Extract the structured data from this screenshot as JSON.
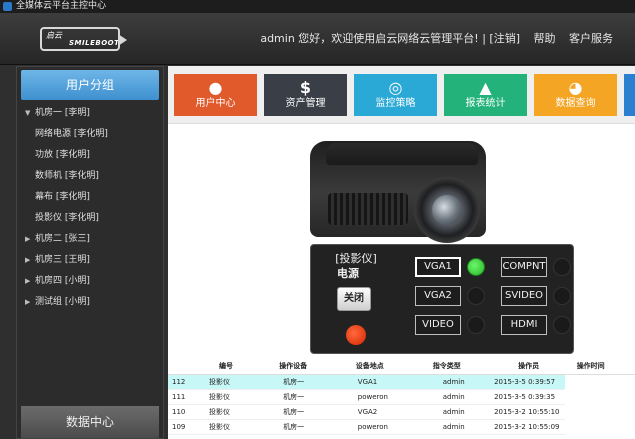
{
  "window": {
    "title": "全媒体云平台主控中心"
  },
  "header": {
    "logo_mark": "启云",
    "logo_text": "SMILEBOOT",
    "welcome": "admin 您好，欢迎使用启云网络云管理平台!",
    "logout": "[注销]",
    "help": "帮助",
    "service": "客户服务"
  },
  "sidebar": {
    "title": "用户分组",
    "items": [
      {
        "label": "机房一 [李明]",
        "type": "group",
        "expanded": true
      },
      {
        "label": "网络电源 [李化明]",
        "type": "child"
      },
      {
        "label": "功放 [李化明]",
        "type": "child"
      },
      {
        "label": "数师机 [李化明]",
        "type": "child"
      },
      {
        "label": "幕布 [李化明]",
        "type": "child"
      },
      {
        "label": "投影仪 [李化明]",
        "type": "child"
      },
      {
        "label": "机房二 [张三]",
        "type": "group",
        "expanded": false
      },
      {
        "label": "机房三 [王明]",
        "type": "group",
        "expanded": false
      },
      {
        "label": "机房四 [小明]",
        "type": "group",
        "expanded": false
      },
      {
        "label": "测试组 [小明]",
        "type": "group",
        "expanded": false
      }
    ],
    "bottom": "数据中心"
  },
  "tiles": [
    {
      "label": "用户中心",
      "icon": "user-icon",
      "color": "#e05a2b",
      "glyph": "●"
    },
    {
      "label": "资产管理",
      "icon": "dollar-icon",
      "color": "#3a3f47",
      "glyph": "$"
    },
    {
      "label": "监控策略",
      "icon": "fingerprint-icon",
      "color": "#2ba9d6",
      "glyph": "◎"
    },
    {
      "label": "报表统计",
      "icon": "chart-icon",
      "color": "#22b27a",
      "glyph": "▲"
    },
    {
      "label": "数据查询",
      "icon": "pie-icon",
      "color": "#f4a523",
      "glyph": "◕"
    }
  ],
  "panel": {
    "device_label": "[投影仪]",
    "power_label": "电源",
    "close_button": "关闭",
    "sources": [
      {
        "label": "VGA1",
        "active": true,
        "led_on": true
      },
      {
        "label": "COMPNT",
        "active": false,
        "led_on": false
      },
      {
        "label": "VGA2",
        "active": false,
        "led_on": false
      },
      {
        "label": "SVIDEO",
        "active": false,
        "led_on": false
      },
      {
        "label": "VIDEO",
        "active": false,
        "led_on": false
      },
      {
        "label": "HDMI",
        "active": false,
        "led_on": false
      }
    ]
  },
  "table": {
    "headers": [
      "编号",
      "操作设备",
      "设备地点",
      "指令类型",
      "操作员",
      "操作时间"
    ],
    "rows": [
      [
        "112",
        "投影仪",
        "机房一",
        "VGA1",
        "admin",
        "2015-3-5 0:39:57"
      ],
      [
        "111",
        "投影仪",
        "机房一",
        "poweron",
        "admin",
        "2015-3-5 0:39:35"
      ],
      [
        "110",
        "投影仪",
        "机房一",
        "VGA2",
        "admin",
        "2015-3-2 10:55:10"
      ],
      [
        "109",
        "投影仪",
        "机房一",
        "poweron",
        "admin",
        "2015-3-2 10:55:09"
      ]
    ]
  }
}
